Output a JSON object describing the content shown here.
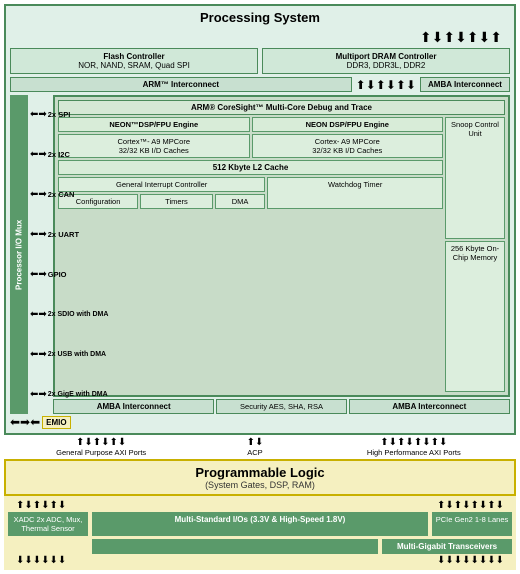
{
  "title": "Processing System",
  "ps": {
    "title": "Processing System",
    "flash_controller": {
      "line1": "Flash Controller",
      "line2": "NOR, NAND, SRAM, Quad SPI"
    },
    "dram_controller": {
      "line1": "Multiport DRAM Controller",
      "line2": "DDR3, DDR3L, DDR2"
    },
    "amba_top": "ARM™ Interconnect",
    "amba_top_right": "AMBA Interconnect",
    "processor_io_mux": "Processor I/O Mux",
    "io_labels": [
      "2x SPI",
      "2x I2C",
      "2x CAN",
      "2x UART",
      "GPIO",
      "2x SDIO with DMA",
      "2x USB with DMA",
      "2x GigE with DMA"
    ],
    "coresight_title": "ARM® CoreSight™ Multi-Core Debug and Trace",
    "neon_left": "NEON™DSP/FPU Engine",
    "neon_right": "NEON DSP/FPU Engine",
    "cortex_left_line1": "Cortex™- A9 MPCore",
    "cortex_left_line2": "32/32 KB I/D Caches",
    "cortex_right_line1": "Cortex- A9 MPCore",
    "cortex_right_line2": "32/32 KB I/D Caches",
    "l2_cache": "512 Kbyte L2 Cache",
    "interrupt_controller": "General Interrupt Controller",
    "watchdog_timer": "Watchdog Timer",
    "snoop_control": "Snoop Control Unit",
    "onchip_memory_label": "256 Kbyte On-Chip Memory",
    "configuration": "Configuration",
    "timers": "Timers",
    "dma": "DMA",
    "amba_bottom_left": "AMBA Interconnect",
    "security": "Security AES, SHA, RSA",
    "amba_bottom_right": "AMBA Interconnect",
    "emio": "EMIO"
  },
  "ports": {
    "general_purpose": "General Purpose AXI Ports",
    "acp": "ACP",
    "high_performance": "High Performance AXI Ports"
  },
  "pl": {
    "title": "Programmable Logic",
    "subtitle": "(System Gates, DSP, RAM)"
  },
  "bottom": {
    "xadc": "XADC 2x ADC, Mux, Thermal Sensor",
    "multi_standard": "Multi-Standard I/Os (3.3V & High-Speed 1.8V)",
    "pcie": "PCIe Gen2 1-8 Lanes",
    "multi_gigabit": "Multi-Gigabit Transceivers"
  }
}
